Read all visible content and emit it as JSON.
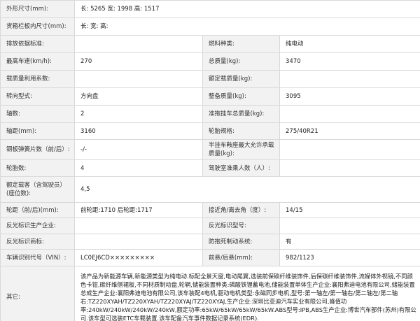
{
  "rows": [
    {
      "l1": "外形尺寸(mm):",
      "v1": "长: 5265 宽: 1998 高: 1517"
    },
    {
      "l1": "货箱栏板内尺寸(mm):",
      "v1": "长: 宽: 高:"
    },
    {
      "l1": "排放依据标准:",
      "v1": "",
      "l2": "燃料种类:",
      "v2": "纯电动"
    },
    {
      "l1": "最高车速(km/h):",
      "v1": "270",
      "l2": "总质量(kg):",
      "v2": "3470"
    },
    {
      "l1": "载质量利用系数:",
      "v1": "",
      "l2": "额定载质量(kg):",
      "v2": ""
    },
    {
      "l1": "转向型式:",
      "v1": "方向盘",
      "l2": "整备质量(kg):",
      "v2": "3095"
    },
    {
      "l1": "轴数:",
      "v1": "2",
      "l2": "准拖挂车总质量(kg):",
      "v2": ""
    },
    {
      "l1": "轴距(mm):",
      "v1": "3160",
      "l2": "轮胎规格:",
      "v2": "275/40R21"
    },
    {
      "l1": "钢板弹簧片数（前/后）:",
      "v1": "-/-",
      "l2": "半挂车鞍座最大允许承载质量(kg):",
      "v2": ""
    },
    {
      "l1": "轮胎数:",
      "v1": "4",
      "l2": "驾驶室准乘人数（人）:",
      "v2": ""
    },
    {
      "l1": "额定载客（含驾驶员）(座位数):",
      "v1": "4,5"
    },
    {
      "l1": "轮距（前/后)(mm):",
      "v1": "前轮距:1710 后轮距:1717",
      "l2": "接近角/离去角（度）:",
      "v2": "14/15"
    },
    {
      "l1": "反光标识生产企业:",
      "v1": "",
      "l2": "反光标识型号:",
      "v2": ""
    },
    {
      "l1": "反光标识商标:",
      "v1": "",
      "l2": "防抱死制动系统:",
      "v2": "有"
    },
    {
      "l1": "车辆识别代号（VIN）:",
      "v1": "LC0EJ6CD×××××××××",
      "l2": "前悬/后悬(mm):",
      "v2": "982/1123"
    }
  ],
  "notes": {
    "label": "其它:",
    "text": "该产品为新能源车辆,新能源类型为纯电动.标配全景天窗,电动尾翼,选装前保碳纤维装饰件,后保碳纤维装饰件,流媒体外视镜,不同颜色卡钳,碳纤维侧裙板,不同材质制动盘,轮辋,储能装置种类:磷酸铁锂蓄电池,储能装置单体生产企业:襄阳弗迪电池有限公司,储能装置总成生产企业:襄阳弗迪电池有限公司,该车装配4电机,驱动电机类型:永磁同步电机,型号:第一轴左/第一轴右/第二轴左/第二轴右:TZ220XYAH/TZ220XYAH/TZ220XYAJ/TZ220XYAJ,生产企业:深圳比亚迪汽车实业有限公司,峰值功率:240kW/240kW/240kW/240kW,额定功率:65kW/65kW/65kW/65kW.ABS型号:IPB,ABS生产企业:博世汽车部件(苏州)有限公司.该车型可选装ETC车载装置.该车配备汽车事件数据记录系统(EDR)."
  }
}
